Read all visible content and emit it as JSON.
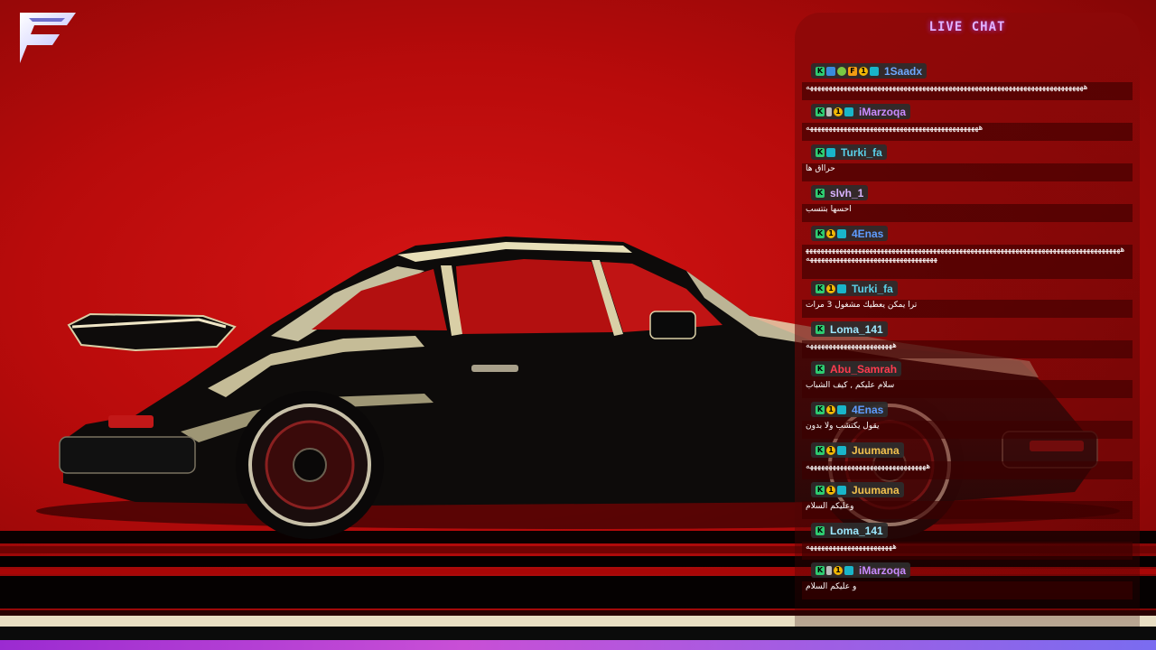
{
  "overlay": {
    "logo_icon": "f-logo-icon",
    "accent": "#b8b8ff"
  },
  "chat": {
    "title": "LIVE CHAT",
    "messages": [
      {
        "user": "1Saadx",
        "color": "#6fa8ff",
        "badges": [
          "k",
          "s",
          "c",
          "f",
          "1",
          "g"
        ],
        "text": "ههههههههههههههههههههههههههههههههههههههههههههههههههههههههههههههههههههههههههه"
      },
      {
        "user": "iMarzoqa",
        "color": "#c98bff",
        "badges": [
          "k",
          "w",
          "1",
          "g"
        ],
        "text": "ههههههههههههههههههههههههههههههههههههههههههههههه"
      },
      {
        "user": "Turki_fa",
        "color": "#5ad0e8",
        "badges": [
          "k",
          "g"
        ],
        "text": "حرااق ها"
      },
      {
        "user": "slvh_1",
        "color": "#d8b4ff",
        "badges": [
          "k"
        ],
        "text": "احسها بتتسب"
      },
      {
        "user": "4Enas",
        "color": "#5f9cff",
        "badges": [
          "k",
          "1",
          "g"
        ],
        "text": "هههههههههههههههههههههههههههههههههههههههههههههههههههههههههههههههههههههههههههههههههههههههههههههههههههههههههههههههههههههههه"
      },
      {
        "user": "Turki_fa",
        "color": "#5ad0e8",
        "badges": [
          "k",
          "1",
          "g"
        ],
        "text": "ترا يمكن يعطيك مشغول 3 مرات"
      },
      {
        "user": "Loma_141",
        "color": "#9de8ff",
        "badges": [
          "k"
        ],
        "text": "هههههههههههههههههههههههه"
      },
      {
        "user": "Abu_Samrah",
        "color": "#ff3b4e",
        "badges": [
          "k"
        ],
        "text": "سلام عليكم , كيف الشباب"
      },
      {
        "user": "4Enas",
        "color": "#5f9cff",
        "badges": [
          "k",
          "1",
          "g"
        ],
        "text": "يقول يكتشب ولا بدون"
      },
      {
        "user": "Juumana",
        "color": "#f2c14e",
        "badges": [
          "k",
          "1",
          "g"
        ],
        "text": "ههههههههههههههههههههههههههههههههه"
      },
      {
        "user": "Juumana",
        "color": "#f2c14e",
        "badges": [
          "k",
          "1",
          "g"
        ],
        "text": "وعليكم السلام"
      },
      {
        "user": "Loma_141",
        "color": "#9de8ff",
        "badges": [
          "k"
        ],
        "text": "هههههههههههههههههههههههه"
      },
      {
        "user": "iMarzoqa",
        "color": "#c98bff",
        "badges": [
          "k",
          "w",
          "1",
          "g"
        ],
        "text": "و عليكم السلام"
      }
    ]
  }
}
